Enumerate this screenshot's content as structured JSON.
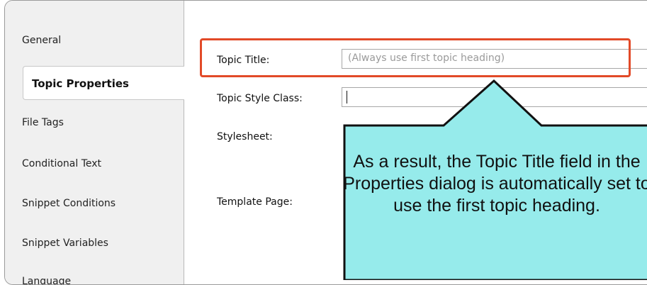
{
  "sidebar": {
    "tabs": [
      {
        "label": "General",
        "active": false
      },
      {
        "label": "Topic Properties",
        "active": true
      },
      {
        "label": "File Tags",
        "active": false
      },
      {
        "label": "Conditional Text",
        "active": false
      },
      {
        "label": "Snippet Conditions",
        "active": false
      },
      {
        "label": "Snippet Variables",
        "active": false
      },
      {
        "label": "Language",
        "active": false
      }
    ]
  },
  "form": {
    "topic_title_label": "Topic Title:",
    "topic_title_placeholder": "(Always use first topic heading)",
    "topic_style_class_label": "Topic Style Class:",
    "topic_style_class_value": "",
    "stylesheet_label": "Stylesheet:",
    "template_page_label": "Template Page:"
  },
  "callout": {
    "text": "As a result, the Topic Title field in the Properties dialog is automatically set to use the first topic heading.",
    "fill_color": "#96ebeb",
    "highlight_color": "#e24a28"
  }
}
